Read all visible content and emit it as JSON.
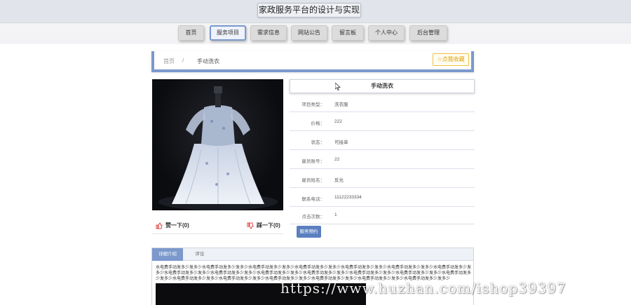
{
  "header": {
    "site_title": "家政服务平台的设计与实现"
  },
  "nav": {
    "items": [
      {
        "label": "首页"
      },
      {
        "label": "服务项目",
        "active": true
      },
      {
        "label": "需求信息"
      },
      {
        "label": "网站公告"
      },
      {
        "label": "留言板"
      },
      {
        "label": "个人中心"
      },
      {
        "label": "后台管理"
      }
    ]
  },
  "breadcrumb": {
    "home": "首页",
    "separator": "/",
    "current": "手动洗衣"
  },
  "collect_button": {
    "icon": "star-icon",
    "label": "点我收藏"
  },
  "votes": {
    "up_label": "赞一下(0)",
    "down_label": "踩一下(0)"
  },
  "detail": {
    "title": "手动洗衣",
    "fields": [
      {
        "label": "项目类型：",
        "value": "洗衣服"
      },
      {
        "label": "价格：",
        "value": "222"
      },
      {
        "label": "状态：",
        "value": "可接单"
      },
      {
        "label": "雇员账号：",
        "value": "22"
      },
      {
        "label": "雇员姓名：",
        "value": "反光"
      },
      {
        "label": "联系电话：",
        "value": "11122233334"
      },
      {
        "label": "点击次数：",
        "value": "1"
      }
    ],
    "book_button": "服务预约"
  },
  "tabs": {
    "items": [
      "详细介绍",
      "评论"
    ],
    "active_index": 0
  },
  "description": "水电费手动发多少发多少水电费手动发多少发多少水电费手动发多少发多少水电费手动发多少发多少水电费手动发多少发多少水电费手动发多少发多少水电费手动发多少发多少水电费手动发多少发多少水电费手动发多少发多少水电费手动发多少发多少水电费手动发多少发多少水电费手动发多少发多少水电费手动发多少发多少水电费手动发多少发多少水电费手动发多少发多少水电费手动发多少发多少水电费手动发多少发多少水电费手动发多少发多少水电费手动发多少发多少水电费手动发多少发多少",
  "watermark": "https://www.huzhan.com/ishop39397",
  "colors": {
    "accent": "#7b99cc",
    "button": "#5b7fbf",
    "collect": "#f0c040",
    "like": "#e04a4a"
  }
}
